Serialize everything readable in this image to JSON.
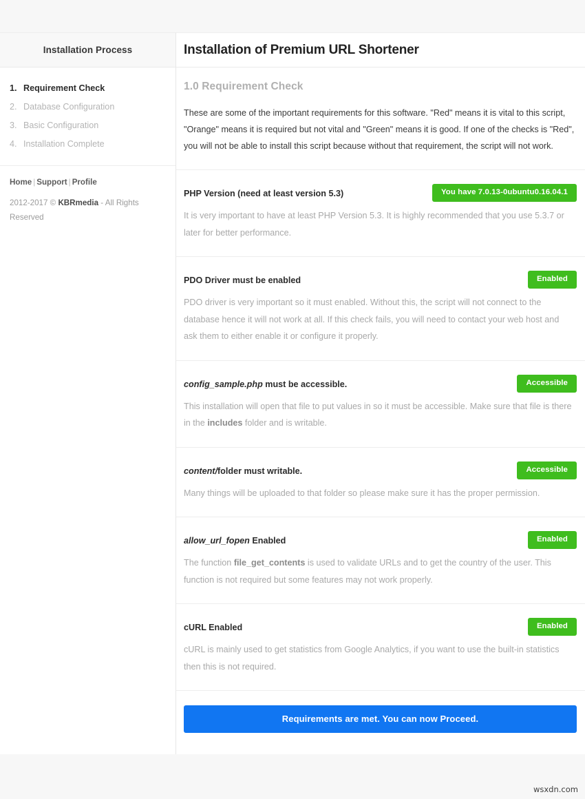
{
  "sidebar": {
    "title": "Installation Process",
    "steps": [
      {
        "num": "1.",
        "label": "Requirement Check",
        "active": true
      },
      {
        "num": "2.",
        "label": "Database Configuration",
        "active": false
      },
      {
        "num": "3.",
        "label": "Basic Configuration",
        "active": false
      },
      {
        "num": "4.",
        "label": "Installation Complete",
        "active": false
      }
    ],
    "footer": {
      "link_home": "Home",
      "link_support": "Support",
      "link_profile": "Profile",
      "separator": "|",
      "copyright_prefix": "2012-2017 © ",
      "copyright_brand": "KBRmedia",
      "copyright_suffix": " - All Rights Reserved"
    }
  },
  "main": {
    "title": "Installation of Premium URL Shortener",
    "section_heading": "1.0 Requirement Check",
    "intro_text": "These are some of the important requirements for this software. \"Red\" means it is vital to this script, \"Orange\" means it is required but not vital and \"Green\" means it is good. If one of the checks is \"Red\", you will not be able to install this script because without that requirement, the script will not work.",
    "requirements": [
      {
        "label_plain": "PHP Version (need at least version 5.3)",
        "label_italic": "",
        "label_rest": "",
        "badge": "You have 7.0.13-0ubuntu0.16.04.1",
        "badge_color": "#3fbd1e",
        "desc_pre": "It is very important to have at least PHP Version 5.3. It is highly recommended that you use 5.3.7 or later for better performance.",
        "desc_bold": "",
        "desc_post": ""
      },
      {
        "label_plain": "PDO Driver must be enabled",
        "label_italic": "",
        "label_rest": "",
        "badge": "Enabled",
        "badge_color": "#3fbd1e",
        "desc_pre": "PDO driver is very important so it must enabled. Without this, the script will not connect to the database hence it will not work at all. If this check fails, you will need to contact your web host and ask them to either enable it or configure it properly.",
        "desc_bold": "",
        "desc_post": ""
      },
      {
        "label_plain": "",
        "label_italic": "config_sample.php",
        "label_rest": " must be accessible.",
        "badge": "Accessible",
        "badge_color": "#3fbd1e",
        "desc_pre": "This installation will open that file to put values in so it must be accessible. Make sure that file is there in the ",
        "desc_bold": "includes",
        "desc_post": " folder and is writable."
      },
      {
        "label_plain": "",
        "label_italic": "content/",
        "label_rest": "folder must writable.",
        "badge": "Accessible",
        "badge_color": "#3fbd1e",
        "desc_pre": "Many things will be uploaded to that folder so please make sure it has the proper permission.",
        "desc_bold": "",
        "desc_post": ""
      },
      {
        "label_plain": "",
        "label_italic": "allow_url_fopen",
        "label_rest": " Enabled",
        "badge": "Enabled",
        "badge_color": "#3fbd1e",
        "desc_pre": "The function ",
        "desc_bold": "file_get_contents",
        "desc_post": " is used to validate URLs and to get the country of the user. This function is not required but some features may not work properly."
      },
      {
        "label_plain": "cURL Enabled",
        "label_italic": "",
        "label_rest": "",
        "badge": "Enabled",
        "badge_color": "#3fbd1e",
        "desc_pre": "cURL is mainly used to get statistics from Google Analytics, if you want to use the built-in statistics then this is not required.",
        "desc_bold": "",
        "desc_post": ""
      }
    ],
    "proceed_label": "Requirements are met. You can now Proceed.",
    "proceed_color": "#1176f2"
  },
  "watermark": "wsxdn.com"
}
